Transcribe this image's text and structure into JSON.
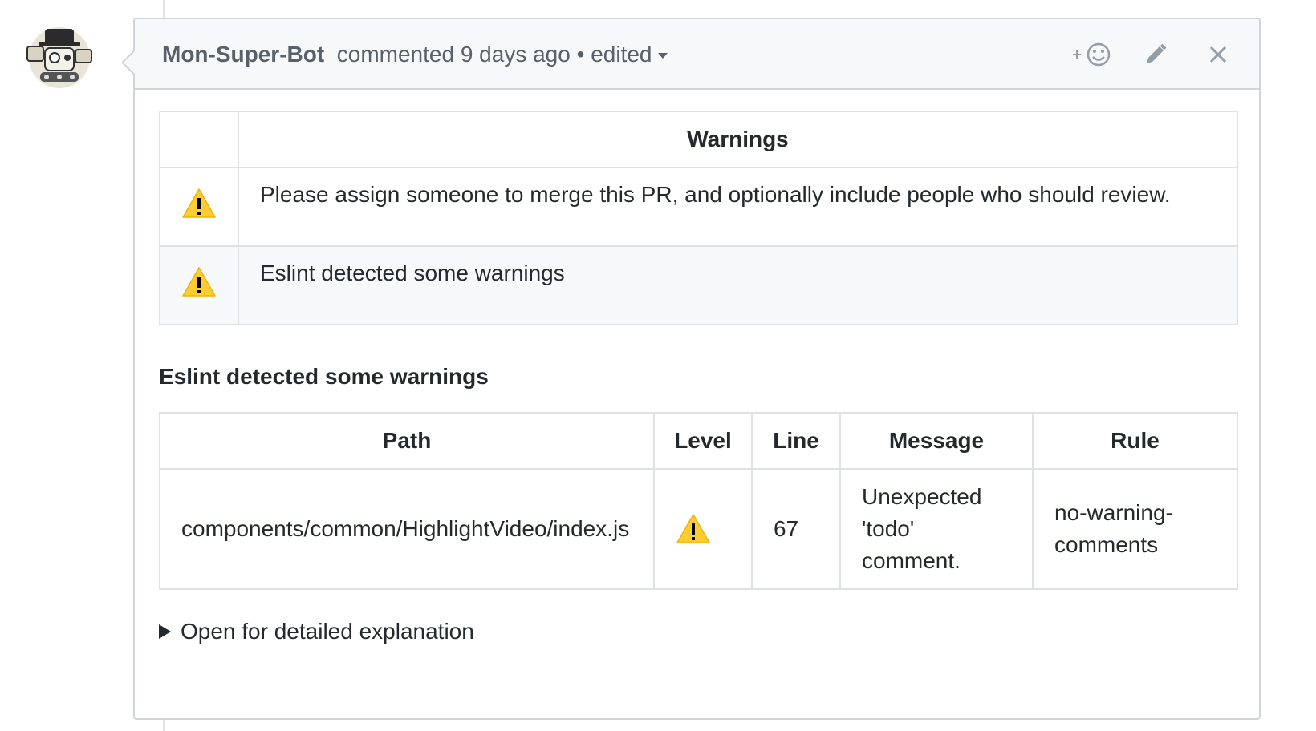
{
  "comment": {
    "author": "Mon-Super-Bot",
    "meta": "commented 9 days ago",
    "separator": "•",
    "edited_label": "edited",
    "add_reaction_icon": "smiley-plus-icon",
    "edit_icon": "pencil-icon",
    "close_icon": "close-icon"
  },
  "warnings_table": {
    "header": "Warnings",
    "rows": [
      {
        "icon": "warning-icon",
        "text": "Please assign someone to merge this PR, and optionally include people who should review."
      },
      {
        "icon": "warning-icon",
        "text": "Eslint detected some warnings"
      }
    ]
  },
  "eslint_section": {
    "title": "Eslint detected some warnings",
    "columns": [
      "Path",
      "Level",
      "Line",
      "Message",
      "Rule"
    ],
    "rows": [
      {
        "path": "components/common/HighlightVideo/index.js",
        "level": "warning-icon",
        "line": "67",
        "message": "Unexpected 'todo' comment.",
        "rule": "no-warning-comments"
      }
    ]
  },
  "details": {
    "summary": "Open for detailed explanation"
  },
  "colors": {
    "warning_yellow": "#ffcc33",
    "border": "#d1d5da",
    "header_bg": "#f6f8fa"
  }
}
